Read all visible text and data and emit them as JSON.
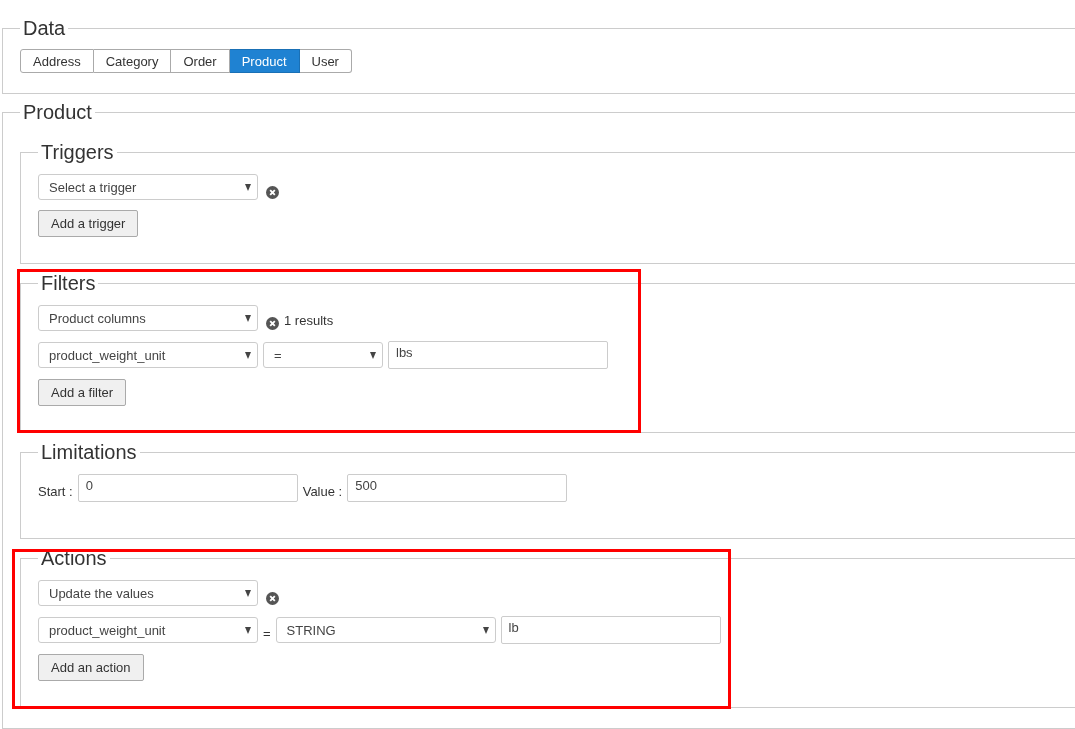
{
  "data_section": {
    "legend": "Data",
    "tabs": [
      {
        "label": "Address",
        "selected": false
      },
      {
        "label": "Category",
        "selected": false
      },
      {
        "label": "Order",
        "selected": false
      },
      {
        "label": "Product",
        "selected": true
      },
      {
        "label": "User",
        "selected": false
      }
    ]
  },
  "product_section": {
    "legend": "Product",
    "subsections": [
      {
        "legend": "Triggers",
        "highlighted": false,
        "rows": [
          {
            "items": [
              {
                "kind": "select",
                "value": "Select a trigger"
              },
              {
                "kind": "remove"
              }
            ]
          }
        ],
        "button": "Add a trigger"
      },
      {
        "legend": "Filters",
        "highlighted": true,
        "rows": [
          {
            "items": [
              {
                "kind": "select",
                "value": "Product columns"
              },
              {
                "kind": "remove"
              },
              {
                "kind": "text",
                "value": "1 results"
              }
            ]
          },
          {
            "items": [
              {
                "kind": "select",
                "value": "product_weight_unit"
              },
              {
                "kind": "operator-select",
                "value": "="
              },
              {
                "kind": "input",
                "value": "lbs"
              }
            ]
          }
        ],
        "button": "Add a filter"
      },
      {
        "legend": "Limitations",
        "highlighted": false,
        "rows": [
          {
            "items": [
              {
                "kind": "label",
                "value": "Start :"
              },
              {
                "kind": "input",
                "value": "0"
              },
              {
                "kind": "label",
                "value": "Value :"
              },
              {
                "kind": "input",
                "value": "500"
              }
            ]
          }
        ]
      },
      {
        "legend": "Actions",
        "highlighted": true,
        "rows": [
          {
            "items": [
              {
                "kind": "select",
                "value": "Update the values"
              },
              {
                "kind": "remove"
              }
            ]
          },
          {
            "items": [
              {
                "kind": "select",
                "value": "product_weight_unit"
              },
              {
                "kind": "label",
                "value": "="
              },
              {
                "kind": "select",
                "value": "STRING"
              },
              {
                "kind": "input",
                "value": "lb"
              }
            ]
          }
        ],
        "button": "Add an action"
      }
    ]
  }
}
